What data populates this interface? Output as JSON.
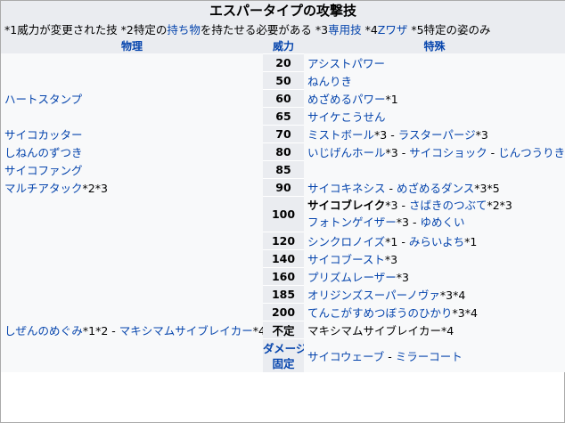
{
  "title": "エスパータイプの攻撃技",
  "notes": {
    "n1": "*1威力が変更された技 *2特定の",
    "n1_link": "持ち物",
    "n2": "を持たせる必要がある *3",
    "n2_link": "専用技",
    "n3": " *4",
    "n3_link": "Zワザ",
    "n4": " *5特定の姿のみ"
  },
  "headers": {
    "physical": "物理",
    "power": "威力",
    "special": "特殊"
  },
  "rows": [
    {
      "power": "20",
      "phys": [],
      "spec": [
        {
          "t": "アシストパワー"
        }
      ]
    },
    {
      "power": "50",
      "phys": [],
      "spec": [
        {
          "t": "ねんりき"
        }
      ]
    },
    {
      "power": "60",
      "phys": [
        {
          "t": "ハートスタンプ"
        }
      ],
      "spec": [
        {
          "t": "めざめるパワー",
          "m": "*1"
        }
      ]
    },
    {
      "power": "65",
      "phys": [],
      "spec": [
        {
          "t": "サイケこうせん"
        }
      ]
    },
    {
      "power": "70",
      "phys": [
        {
          "t": "サイコカッター"
        }
      ],
      "spec": [
        {
          "t": "ミストボール",
          "m": "*3"
        },
        {
          "t": "ラスターパージ",
          "m": "*3"
        }
      ]
    },
    {
      "power": "80",
      "phys": [
        {
          "t": "しねんのずつき"
        }
      ],
      "spec": [
        {
          "t": "いじげんホール",
          "m": "*3"
        },
        {
          "t": "サイコショック"
        },
        {
          "t": "じんつうりき"
        }
      ]
    },
    {
      "power": "85",
      "phys": [
        {
          "t": "サイコファング"
        }
      ],
      "spec": []
    },
    {
      "power": "90",
      "phys": [
        {
          "t": "マルチアタック",
          "m": "*2*3"
        }
      ],
      "spec": [
        {
          "t": "サイコキネシス"
        },
        {
          "t": "めざめるダンス",
          "m": "*3*5"
        }
      ]
    },
    {
      "power": "100",
      "phys": [],
      "spec_lines": [
        [
          {
            "t": "サイコブレイク",
            "m": "*3",
            "bold": true
          },
          {
            "t": "さばきのつぶて",
            "m": "*2*3"
          }
        ],
        [
          {
            "t": "フォトンゲイザー",
            "m": "*3"
          },
          {
            "t": "ゆめくい"
          }
        ]
      ]
    },
    {
      "power": "120",
      "phys": [],
      "spec": [
        {
          "t": "シンクロノイズ",
          "m": "*1"
        },
        {
          "t": "みらいよち",
          "m": "*1"
        }
      ]
    },
    {
      "power": "140",
      "phys": [],
      "spec": [
        {
          "t": "サイコブースト",
          "m": "*3"
        }
      ]
    },
    {
      "power": "160",
      "phys": [],
      "spec": [
        {
          "t": "プリズムレーザー",
          "m": "*3"
        }
      ]
    },
    {
      "power": "185",
      "phys": [],
      "spec": [
        {
          "t": "オリジンズスーパーノヴァ",
          "m": "*3*4"
        }
      ]
    },
    {
      "power": "200",
      "phys": [],
      "spec": [
        {
          "t": "てんこがすめつぼうのひかり",
          "m": "*3*4"
        }
      ]
    },
    {
      "power": "不定",
      "phys": [
        {
          "t": "しぜんのめぐみ",
          "m": "*1*2"
        },
        {
          "t": "マキシマムサイブレイカー",
          "m": "*4"
        }
      ],
      "spec": [
        {
          "t": "マキシマムサイブレイカー",
          "m": "*4",
          "plain": true
        }
      ]
    }
  ],
  "fixed_row": {
    "power_line1": "ダメージ",
    "power_line2": "固定",
    "spec": [
      {
        "t": "サイコウェーブ"
      },
      {
        "t": "ミラーコート"
      }
    ]
  },
  "separator": " - "
}
